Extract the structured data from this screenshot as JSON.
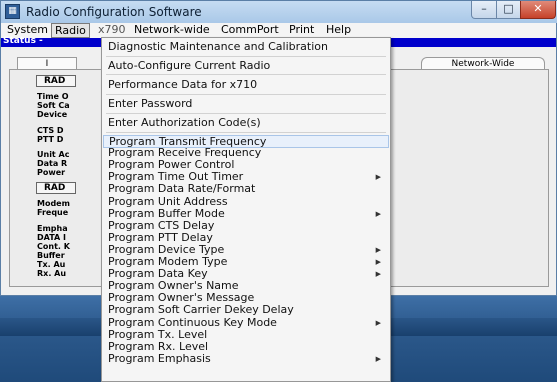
{
  "window": {
    "title": "Radio Configuration Software",
    "controls": {
      "minimize": "–",
      "maximize": "□",
      "close": "✕"
    }
  },
  "menubar": {
    "items": [
      "System",
      "Radio",
      "x790",
      "Network-wide",
      "CommPort",
      "Print",
      "Help"
    ],
    "active": "Radio"
  },
  "status": {
    "label": "Status -"
  },
  "tabs": {
    "left": "I",
    "right": "Network-Wide"
  },
  "panel": {
    "group1": "RAD",
    "labels1": [
      "Time O",
      "Soft Ca",
      "Device"
    ],
    "labels2": [
      "CTS D",
      "PTT D"
    ],
    "labels3": [
      "Unit Ac",
      "Data R",
      "Power"
    ],
    "group2": "RAD",
    "labels4": [
      "Modem",
      "Freque"
    ],
    "labels5": [
      "Empha",
      "DATA I",
      "Cont. K",
      "Buffer",
      "Tx. Au",
      "Rx. Au"
    ]
  },
  "radio_menu": {
    "header_items": [
      "Diagnostic Maintenance and Calibration",
      "Auto-Configure Current Radio",
      "Performance Data for x710",
      "Enter Password",
      "Enter Authorization Code(s)"
    ],
    "program_items": [
      {
        "label": "Program Transmit Frequency",
        "submenu": false,
        "highlighted": true
      },
      {
        "label": "Program Receive Frequency",
        "submenu": false
      },
      {
        "label": "Program Power Control",
        "submenu": false
      },
      {
        "label": "Program Time Out Timer",
        "submenu": true
      },
      {
        "label": "Program Data Rate/Format",
        "submenu": false
      },
      {
        "label": "Program Unit Address",
        "submenu": false
      },
      {
        "label": "Program Buffer Mode",
        "submenu": true
      },
      {
        "label": "Program CTS Delay",
        "submenu": false
      },
      {
        "label": "Program PTT Delay",
        "submenu": false
      },
      {
        "label": "Program Device Type",
        "submenu": true
      },
      {
        "label": "Program Modem Type",
        "submenu": true
      },
      {
        "label": "Program Data Key",
        "submenu": true
      },
      {
        "label": "Program Owner's Name",
        "submenu": false
      },
      {
        "label": "Program Owner's Message",
        "submenu": false
      },
      {
        "label": "Program Soft Carrier Dekey Delay",
        "submenu": false
      },
      {
        "label": "Program Continuous Key Mode",
        "submenu": true
      },
      {
        "label": "Program Tx. Level",
        "submenu": false
      },
      {
        "label": "Program Rx. Level",
        "submenu": false
      },
      {
        "label": "Program Emphasis",
        "submenu": true
      }
    ]
  }
}
